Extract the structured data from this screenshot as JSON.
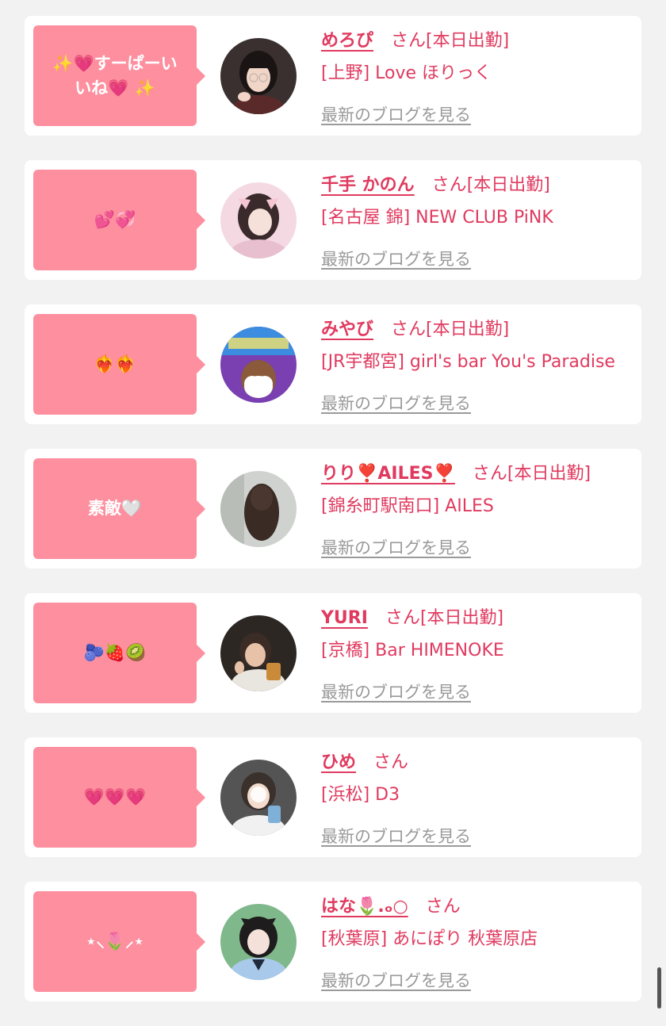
{
  "cards": [
    {
      "comment": "✨💗すーぱーいいね💗 ✨",
      "name": "めろぴ",
      "san": "さん",
      "status": "[本日出勤]",
      "shop": "[上野] Love ほりっく",
      "blog": "最新のブログを見る"
    },
    {
      "comment": "💕💞",
      "name": "千手 かのん",
      "san": "さん",
      "status": "[本日出勤]",
      "shop": "[名古屋 錦] NEW CLUB PiNK",
      "blog": "最新のブログを見る"
    },
    {
      "comment": "❤️‍🔥❤️‍🔥",
      "name": "みやび",
      "san": "さん",
      "status": "[本日出勤]",
      "shop": "[JR宇都宮] girl's bar You's Paradise",
      "blog": "最新のブログを見る"
    },
    {
      "comment": "素敵🤍",
      "name": "りり❣️AILES❣️",
      "san": "さん",
      "status": "[本日出勤]",
      "shop": "[錦糸町駅南口] AILES",
      "blog": "最新のブログを見る"
    },
    {
      "comment": "🫐🍓🥝",
      "name": "YURI",
      "san": "さん",
      "status": "[本日出勤]",
      "shop": "[京橋] Bar HIMENOKE",
      "blog": "最新のブログを見る"
    },
    {
      "comment": "💗💗💗",
      "name": "ひめ",
      "san": "さん",
      "status": "",
      "shop": "[浜松] D3",
      "blog": "最新のブログを見る"
    },
    {
      "comment": "⋆⸜🌷⸝⋆",
      "name": "はな🌷.ₒ○",
      "san": "さん",
      "status": "",
      "shop": "[秋葉原] あにぽり 秋葉原店",
      "blog": "最新のブログを見る"
    }
  ],
  "colors": {
    "accent": "#e03a5f",
    "bubble": "#fd8f9f",
    "link_gray": "#9a9a9a",
    "background": "#f2f2f3"
  }
}
